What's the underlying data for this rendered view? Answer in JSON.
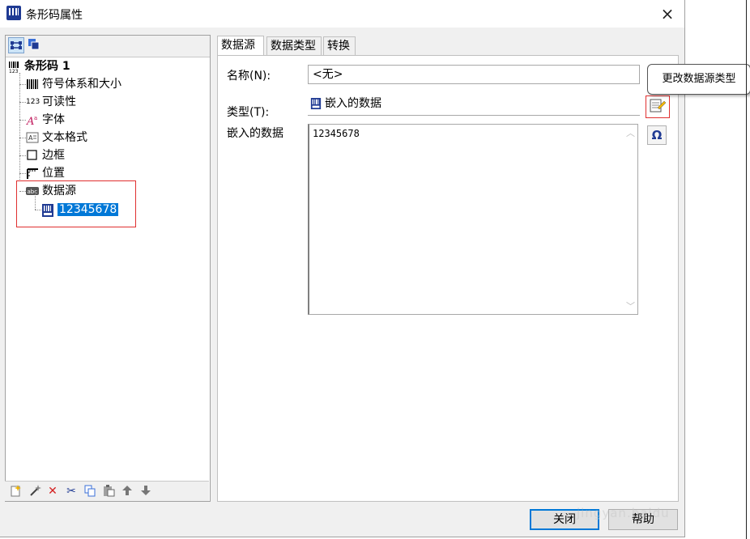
{
  "window": {
    "title": "条形码属性",
    "close_glyph": "×"
  },
  "tree": {
    "root": "条形码 1",
    "items": [
      {
        "label": "符号体系和大小",
        "icon": "barcode-icon"
      },
      {
        "label": "可读性",
        "icon": "readable-text-icon"
      },
      {
        "label": "字体",
        "icon": "font-icon"
      },
      {
        "label": "文本格式",
        "icon": "text-format-icon"
      },
      {
        "label": "边框",
        "icon": "border-icon"
      },
      {
        "label": "位置",
        "icon": "position-icon"
      },
      {
        "label": "数据源",
        "icon": "data-source-icon"
      }
    ],
    "child": {
      "label": "12345678",
      "icon": "embedded-data-icon"
    },
    "numeric_glyph": "123",
    "abc_glyph": "abc"
  },
  "tabs": [
    "数据源",
    "数据类型",
    "转换"
  ],
  "form": {
    "name_label": "名称(N):",
    "name_value": "<无>",
    "type_label": "类型(T):",
    "type_value": "嵌入的数据",
    "embedded_label": "嵌入的数据",
    "embedded_value": "12345678"
  },
  "tooltip": "更改数据源类型",
  "buttons": {
    "close": "关闭",
    "help": "帮助"
  },
  "watermark": "jingyan.baidu",
  "colors": {
    "selection": "#0078d7",
    "highlight_box": "#e03030",
    "icon_blue": "#1f3a93"
  }
}
